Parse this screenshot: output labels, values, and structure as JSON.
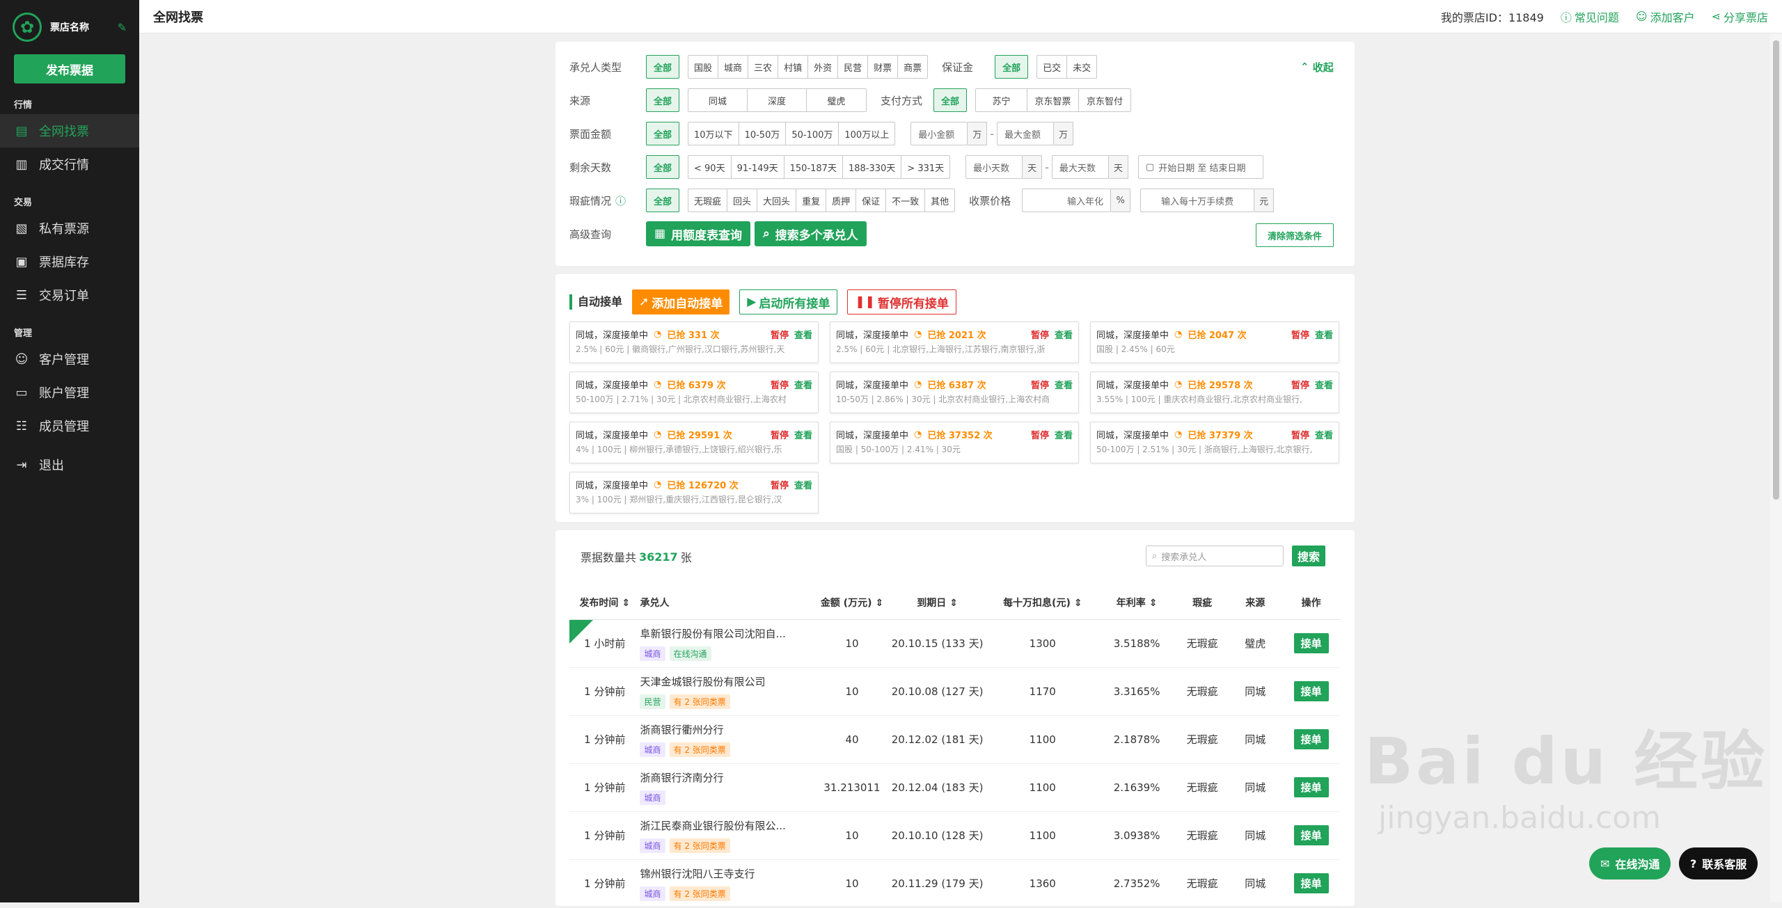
{
  "sidebar": {
    "shop_name": "票店名称",
    "publish": "发布票据",
    "sections": [
      {
        "title": "行情",
        "items": [
          {
            "label": "全网找票",
            "icon": "ticket-icon",
            "active": true
          },
          {
            "label": "成交行情",
            "icon": "chart-icon"
          }
        ]
      },
      {
        "title": "交易",
        "items": [
          {
            "label": "私有票源",
            "icon": "doc-icon"
          },
          {
            "label": "票据库存",
            "icon": "box-icon"
          },
          {
            "label": "交易订单",
            "icon": "order-icon"
          }
        ]
      },
      {
        "title": "管理",
        "items": [
          {
            "label": "客户管理",
            "icon": "user-icon"
          },
          {
            "label": "账户管理",
            "icon": "wallet-icon"
          },
          {
            "label": "成员管理",
            "icon": "team-icon"
          }
        ]
      }
    ],
    "logout": "退出"
  },
  "topbar": {
    "title": "全网找票",
    "shop_id_label": "我的票店ID：",
    "shop_id": "11849",
    "faq": "常见问题",
    "add_customer": "添加客户",
    "share": "分享票店"
  },
  "filter": {
    "acceptor_type": {
      "label": "承兑人类型",
      "all": "全部",
      "options": [
        "国股",
        "城商",
        "三农",
        "村镇",
        "外资",
        "民营",
        "财票",
        "商票"
      ]
    },
    "deposit": {
      "label": "保证金",
      "all": "全部",
      "options": [
        "已交",
        "未交"
      ]
    },
    "collapse": "收起",
    "source": {
      "label": "来源",
      "all": "全部",
      "options": [
        "同城",
        "深度",
        "璧虎"
      ]
    },
    "payment": {
      "label": "支付方式",
      "all": "全部",
      "options": [
        "苏宁",
        "京东智票",
        "京东智付"
      ]
    },
    "amount": {
      "label": "票面金额",
      "all": "全部",
      "options": [
        "10万以下",
        "10-50万",
        "50-100万",
        "100万以上"
      ],
      "min_ph": "最小金额",
      "max_ph": "最大金额",
      "unit": "万"
    },
    "days": {
      "label": "剩余天数",
      "all": "全部",
      "options": [
        "< 90天",
        "91-149天",
        "150-187天",
        "188-330天",
        "> 331天"
      ],
      "min_ph": "最小天数",
      "max_ph": "最大天数",
      "unit": "天",
      "date_ph": "开始日期 至 结束日期"
    },
    "defect": {
      "label": "瑕疵情况",
      "all": "全部",
      "options": [
        "无瑕疵",
        "回头",
        "大回头",
        "重复",
        "质押",
        "保证",
        "不一致",
        "其他"
      ]
    },
    "price": {
      "label": "收票价格",
      "rate_ph": "输入年化",
      "rate_unit": "%",
      "fee_ph": "输入每十万手续费",
      "fee_unit": "元"
    },
    "advanced": {
      "label": "高级查询",
      "by_table": "用额度表查询",
      "multi_search": "搜索多个承兑人",
      "clear": "清除筛选条件"
    }
  },
  "auto": {
    "title": "自动接单",
    "add": "添加自动接单",
    "start_all": "启动所有接单",
    "pause_all": "暂停所有接单",
    "cards": [
      {
        "status": "同城，深度接单中",
        "grabbed": "已抢 331 次",
        "pause": "暂停",
        "view": "查看",
        "detail": "2.5% | 60元 | 徽商银行,广州银行,汉口银行,苏州银行,天"
      },
      {
        "status": "同城，深度接单中",
        "grabbed": "已抢 2021 次",
        "pause": "暂停",
        "view": "查看",
        "detail": "2.5% | 60元 | 北京银行,上海银行,江苏银行,南京银行,浙"
      },
      {
        "status": "同城，深度接单中",
        "grabbed": "已抢 2047 次",
        "pause": "暂停",
        "view": "查看",
        "detail": "国股 | 2.45% | 60元"
      },
      {
        "status": "同城，深度接单中",
        "grabbed": "已抢 6379 次",
        "pause": "暂停",
        "view": "查看",
        "detail": "50-100万 | 2.71% | 30元 | 北京农村商业银行,上海农村"
      },
      {
        "status": "同城，深度接单中",
        "grabbed": "已抢 6387 次",
        "pause": "暂停",
        "view": "查看",
        "detail": "10-50万 | 2.86% | 30元 | 北京农村商业银行,上海农村商"
      },
      {
        "status": "同城，深度接单中",
        "grabbed": "已抢 29578 次",
        "pause": "暂停",
        "view": "查看",
        "detail": "3.55% | 100元 | 重庆农村商业银行,北京农村商业银行,"
      },
      {
        "status": "同城，深度接单中",
        "grabbed": "已抢 29591 次",
        "pause": "暂停",
        "view": "查看",
        "detail": "4% | 100元 | 柳州银行,承德银行,上饶银行,绍兴银行,乐"
      },
      {
        "status": "同城，深度接单中",
        "grabbed": "已抢 37352 次",
        "pause": "暂停",
        "view": "查看",
        "detail": "国股 | 50-100万 | 2.41% | 30元"
      },
      {
        "status": "同城，深度接单中",
        "grabbed": "已抢 37379 次",
        "pause": "暂停",
        "view": "查看",
        "detail": "50-100万 | 2.51% | 30元 | 浙商银行,上海银行,北京银行,"
      },
      {
        "status": "同城，深度接单中",
        "grabbed": "已抢 126720 次",
        "pause": "暂停",
        "view": "查看",
        "detail": "3% | 100元 | 郑州银行,重庆银行,江西银行,昆仑银行,汉"
      }
    ]
  },
  "list": {
    "count_prefix": "票据数量共",
    "count": "36217",
    "count_suffix": "张",
    "search_ph": "搜索承兑人",
    "search": "搜索",
    "columns": [
      "发布时间 ⇕",
      "承兑人",
      "金额 (万元) ⇕",
      "到期日 ⇕",
      "每十万扣息(元) ⇕",
      "年利率 ⇕",
      "瑕疵",
      "来源",
      "操作"
    ],
    "rows": [
      {
        "time": "1 小时前",
        "acceptor": "阜新银行股份有限公司沈阳自...",
        "tags": [
          "城商",
          "在线沟通"
        ],
        "amount": "10",
        "due": "20.10.15 (133 天)",
        "deduct": "1300",
        "rate": "3.5188%",
        "defect": "无瑕疵",
        "source": "璧虎",
        "op": "接单",
        "new": true
      },
      {
        "time": "1 分钟前",
        "acceptor": "天津金城银行股份有限公司",
        "tags": [
          "民营",
          "有 2 张同类票"
        ],
        "amount": "10",
        "due": "20.10.08 (127 天)",
        "deduct": "1170",
        "rate": "3.3165%",
        "defect": "无瑕疵",
        "source": "同城",
        "op": "接单"
      },
      {
        "time": "1 分钟前",
        "acceptor": "浙商银行衢州分行",
        "tags": [
          "城商",
          "有 2 张同类票"
        ],
        "amount": "40",
        "due": "20.12.02 (181 天)",
        "deduct": "1100",
        "rate": "2.1878%",
        "defect": "无瑕疵",
        "source": "同城",
        "op": "接单"
      },
      {
        "time": "1 分钟前",
        "acceptor": "浙商银行济南分行",
        "tags": [
          "城商"
        ],
        "amount": "31.213011",
        "due": "20.12.04 (183 天)",
        "deduct": "1100",
        "rate": "2.1639%",
        "defect": "无瑕疵",
        "source": "同城",
        "op": "接单"
      },
      {
        "time": "1 分钟前",
        "acceptor": "浙江民泰商业银行股份有限公...",
        "tags": [
          "城商",
          "有 2 张同类票"
        ],
        "amount": "10",
        "due": "20.10.10 (128 天)",
        "deduct": "1100",
        "rate": "3.0938%",
        "defect": "无瑕疵",
        "source": "同城",
        "op": "接单"
      },
      {
        "time": "1 分钟前",
        "acceptor": "锦州银行沈阳八王寺支行",
        "tags": [
          "城商",
          "有 2 张同类票"
        ],
        "amount": "10",
        "due": "20.11.29 (179 天)",
        "deduct": "1360",
        "rate": "2.7352%",
        "defect": "无瑕疵",
        "source": "同城",
        "op": "接单"
      }
    ]
  },
  "float": {
    "chat": "在线沟通",
    "service": "联系客服"
  },
  "watermark": {
    "brand": "Bai du 经验",
    "url": "jingyan.baidu.com"
  },
  "colors": {
    "brand": "#21a35a",
    "orange": "#ff8c00",
    "red": "#e03030"
  }
}
